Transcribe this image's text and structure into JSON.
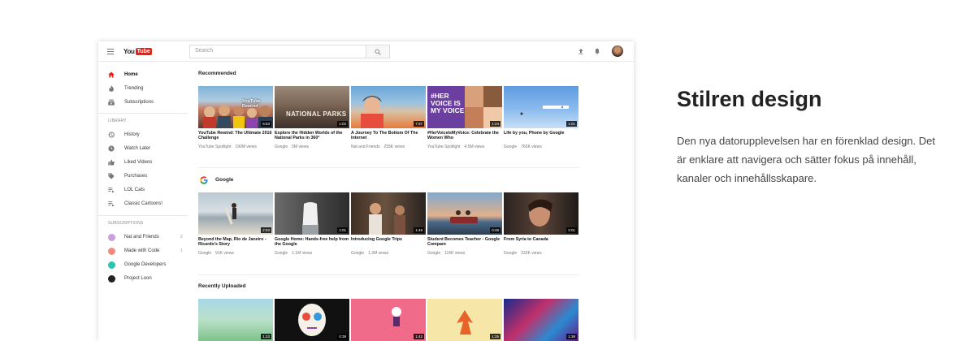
{
  "topbar": {
    "logo_you": "You",
    "logo_tube": "Tube",
    "search_placeholder": "Search"
  },
  "sidebar": {
    "main_items": [
      {
        "label": "Home",
        "icon": "home-icon"
      },
      {
        "label": "Trending",
        "icon": "flame-icon"
      },
      {
        "label": "Subscriptions",
        "icon": "subscriptions-icon"
      }
    ],
    "library_heading": "LIBRARY",
    "library_items": [
      {
        "label": "History",
        "icon": "history-icon"
      },
      {
        "label": "Watch Later",
        "icon": "clock-icon"
      },
      {
        "label": "Liked Videos",
        "icon": "thumbs-up-icon"
      },
      {
        "label": "Purchases",
        "icon": "tag-icon"
      },
      {
        "label": "LOL Cats",
        "icon": "playlist-icon"
      },
      {
        "label": "Classic Cartoons!",
        "icon": "playlist-icon"
      }
    ],
    "subscriptions_heading": "SUBSCRIPTIONS",
    "channels": [
      {
        "label": "Nat and Friends",
        "count": "2",
        "color": "#c9a0dc"
      },
      {
        "label": "Made with Code",
        "count": "1",
        "color": "#f28b82"
      },
      {
        "label": "Google Developers",
        "count": "",
        "color": "#26c6b0"
      },
      {
        "label": "Project Loon",
        "count": "",
        "color": "#222222"
      }
    ]
  },
  "sections": [
    {
      "title": "Recommended",
      "videos": [
        {
          "title": "YouTube Rewind: The Ultimate 2016 Challenge",
          "channel": "YouTube Spotlight",
          "views": "190M views",
          "duration": "6:53"
        },
        {
          "title": "Explore the Hidden Worlds of the National Parks in 360°",
          "channel": "Google",
          "views": "5M views",
          "duration": "1:02"
        },
        {
          "title": "A Journey To The Bottom Of The Internet",
          "channel": "Nat and Friends",
          "views": "255K views",
          "duration": "7:37"
        },
        {
          "title": "#HerVoiceIsMyVoice: Celebrate the Women Who",
          "channel": "YouTube Spotlight",
          "views": "4.5M views",
          "duration": "1:24"
        },
        {
          "title": "Life by you, Phone by Google",
          "channel": "Google",
          "views": "760K views",
          "duration": "1:01"
        }
      ]
    },
    {
      "title": "Google",
      "videos": [
        {
          "title": "Beyond the Map, Rio de Janeiro - Ricardo's Story",
          "channel": "Google",
          "views": "91K views",
          "duration": "2:53"
        },
        {
          "title": "Google Home: Hands-free help from the Google",
          "channel": "Google",
          "views": "1.1M views",
          "duration": "1:01"
        },
        {
          "title": "Introducing Google Trips",
          "channel": "Google",
          "views": "1.3M views",
          "duration": "1:49"
        },
        {
          "title": "Student Becomes Teacher - Google Compare",
          "channel": "Google",
          "views": "116K views",
          "duration": "0:48"
        },
        {
          "title": "From Syria to Canada",
          "channel": "Google",
          "views": "333K views",
          "duration": "2:01"
        }
      ]
    },
    {
      "title": "Recently Uploaded",
      "videos": [
        {
          "duration": "1:23"
        },
        {
          "duration": "0:39"
        },
        {
          "duration": "1:42"
        },
        {
          "duration": "1:25"
        },
        {
          "duration": "1:38"
        }
      ]
    }
  ],
  "thumb_text": {
    "rewind": "YouTube Rewind",
    "parks": "NATIONAL PARKS",
    "her_voice": "#HER VOICE IS MY VOICE"
  },
  "promo": {
    "headline": "Stilren design",
    "description": "Den nya datorupplevelsen har en förenklad design. Det är enklare att navigera och sätter fokus på innehåll, kanaler och innehållsskapare."
  },
  "colors": {
    "brand_red": "#e62117",
    "google_blue": "#4285f4"
  }
}
